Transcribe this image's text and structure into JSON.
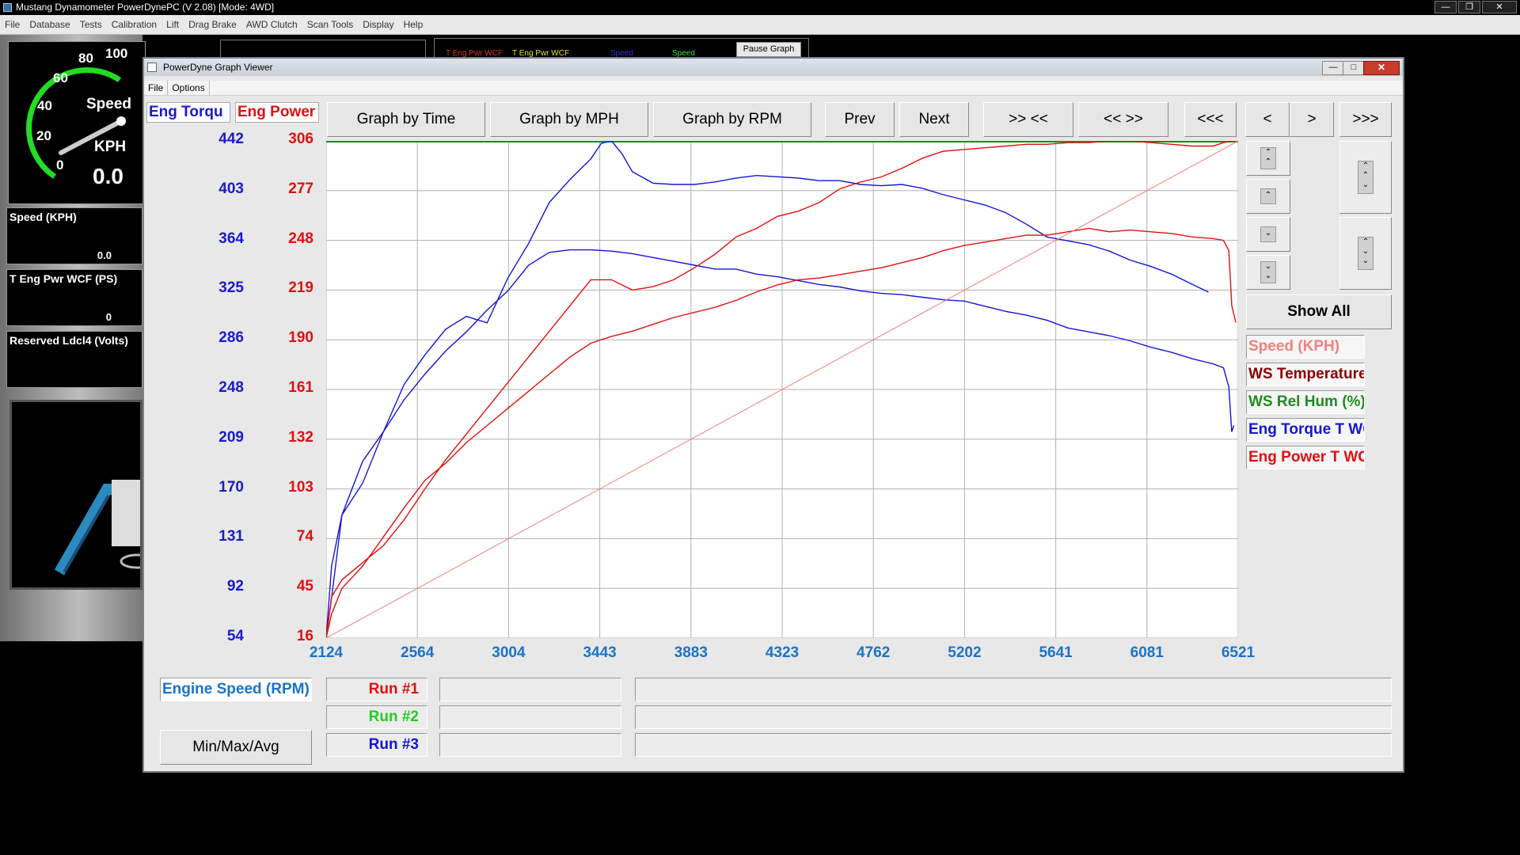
{
  "app": {
    "title": "Mustang Dynamometer PowerDynePC (V 2.08) [Mode: 4WD]",
    "menu": [
      "File",
      "Database",
      "Tests",
      "Calibration",
      "Lift",
      "Drag Brake",
      "AWD Clutch",
      "Scan Tools",
      "Display",
      "Help"
    ]
  },
  "gauge": {
    "ticks": [
      "0",
      "20",
      "40",
      "60",
      "80",
      "100"
    ],
    "label": "Speed",
    "unit": "KPH",
    "value": "0.0",
    "fraction": 0.0
  },
  "side_panels": [
    {
      "label": "Speed (KPH)",
      "value": "0.0"
    },
    {
      "label": "T Eng Pwr WCF (PS)",
      "value": "0"
    },
    {
      "label": "Reserved Ldcl4 (Volts)",
      "value": ""
    }
  ],
  "bg_toolbar": {
    "pause_label": "Pause Graph",
    "legend_a": "T Eng Pwr WCF",
    "legend_b": "T Eng Pwr WCF",
    "legend_c": "Speed",
    "legend_d": "Speed"
  },
  "viewer": {
    "title": "PowerDyne Graph Viewer",
    "menu": [
      "File",
      "Options"
    ],
    "buttons": {
      "by_time": "Graph by Time",
      "by_mph": "Graph by MPH",
      "by_rpm": "Graph by RPM",
      "prev": "Prev",
      "next": "Next",
      "zoom_in": ">> <<",
      "zoom_out": "<< >>",
      "first": "<<<",
      "back": "<",
      "fwd": ">",
      "last": ">>>",
      "show_all": "Show All",
      "min_max_avg": "Min/Max/Avg"
    },
    "legend": [
      {
        "label": "Speed (KPH)",
        "color": "#f08080"
      },
      {
        "label": "WS Temperature (D",
        "color": "#8b0000"
      },
      {
        "label": "WS Rel Hum (%)",
        "color": "#1e8b1e"
      },
      {
        "label": "Eng Torque T WC (N",
        "color": "#1515d0"
      },
      {
        "label": "Eng Power T WC (P",
        "color": "#e01010"
      }
    ],
    "x_axis_label": "Engine Speed (RPM)",
    "runs": [
      {
        "label": "Run #1",
        "color": "#e01010"
      },
      {
        "label": "Run #2",
        "color": "#22cc22"
      },
      {
        "label": "Run #3",
        "color": "#1515d0"
      }
    ]
  },
  "chart_data": {
    "type": "line",
    "y_left_label": "Eng Torqu",
    "y_right_label": "Eng Power",
    "y_left_ticks": [
      "442",
      "403",
      "364",
      "325",
      "286",
      "248",
      "209",
      "170",
      "131",
      "92",
      "54"
    ],
    "y_right_ticks": [
      "306",
      "277",
      "248",
      "219",
      "190",
      "161",
      "132",
      "103",
      "74",
      "45",
      "16"
    ],
    "x_ticks": [
      "2124",
      "2564",
      "3004",
      "3443",
      "3883",
      "4323",
      "4762",
      "5202",
      "5641",
      "6081",
      "6521"
    ],
    "xlim": [
      2124,
      6521
    ],
    "ylim_left": [
      54,
      442
    ],
    "ylim_right": [
      16,
      306
    ],
    "grid": true,
    "series": [
      {
        "name": "Eng Torque T WC (N",
        "axis": "left",
        "color": "#1515d0",
        "x": [
          2124,
          2150,
          2200,
          2300,
          2400,
          2500,
          2600,
          2700,
          2800,
          2900,
          3000,
          3100,
          3200,
          3300,
          3400,
          3450,
          3500,
          3550,
          3600,
          3700,
          3800,
          3900,
          4000,
          4100,
          4200,
          4300,
          4400,
          4500,
          4600,
          4700,
          4800,
          4900,
          5000,
          5100,
          5200,
          5300,
          5400,
          5500,
          5600,
          5700,
          5800,
          5900,
          6000,
          6100,
          6200,
          6300,
          6378
        ],
        "y": [
          54,
          85,
          150,
          192,
          215,
          252,
          275,
          295,
          305,
          300,
          335,
          362,
          394,
          412,
          428,
          440,
          442,
          432,
          418,
          409,
          408,
          408,
          410,
          413,
          415,
          414,
          413,
          411,
          411,
          408,
          407,
          408,
          405,
          400,
          396,
          392,
          386,
          377,
          367,
          364,
          361,
          356,
          349,
          344,
          338,
          330,
          324
        ]
      },
      {
        "name": "Eng Torque T WC (N",
        "axis": "left",
        "color": "#1515d0",
        "x": [
          2124,
          2150,
          2200,
          2300,
          2400,
          2500,
          2600,
          2700,
          2800,
          2900,
          3000,
          3100,
          3200,
          3300,
          3400,
          3500,
          3600,
          3700,
          3800,
          3900,
          4000,
          4100,
          4200,
          4300,
          4400,
          4500,
          4600,
          4700,
          4800,
          4900,
          5000,
          5100,
          5200,
          5300,
          5400,
          5500,
          5600,
          5700,
          5800,
          5900,
          6000,
          6100,
          6200,
          6300,
          6400,
          6450,
          6476,
          6490,
          6500
        ],
        "y": [
          54,
          110,
          150,
          175,
          215,
          240,
          260,
          278,
          293,
          310,
          325,
          345,
          355,
          357,
          357,
          356,
          354,
          351,
          348,
          345,
          342,
          342,
          338,
          336,
          333,
          330,
          328,
          325,
          323,
          322,
          320,
          318,
          317,
          313,
          309,
          306,
          302,
          296,
          293,
          290,
          286,
          281,
          277,
          272,
          268,
          265,
          250,
          215,
          220
        ]
      },
      {
        "name": "Eng Power T WC (P",
        "axis": "right",
        "color": "#e01010",
        "x": [
          2124,
          2150,
          2200,
          2300,
          2400,
          2500,
          2600,
          2700,
          2800,
          2900,
          3000,
          3100,
          3200,
          3300,
          3400,
          3500,
          3600,
          3700,
          3800,
          3900,
          4000,
          4100,
          4200,
          4300,
          4400,
          4500,
          4600,
          4700,
          4800,
          4900,
          5000,
          5100,
          5200,
          5300,
          5400,
          5500,
          5600,
          5700,
          5800,
          5900,
          6000,
          6100,
          6200,
          6300,
          6400,
          6450,
          6490,
          6510
        ],
        "y": [
          16,
          40,
          50,
          60,
          70,
          85,
          103,
          120,
          135,
          150,
          165,
          180,
          195,
          210,
          225,
          225,
          219,
          221,
          225,
          232,
          240,
          250,
          255,
          262,
          265,
          270,
          278,
          282,
          285,
          290,
          296,
          300,
          301,
          302,
          303,
          304,
          304,
          305,
          305,
          306,
          306,
          305,
          304,
          303,
          303,
          305,
          306,
          306
        ]
      },
      {
        "name": "Eng Power T WC (P",
        "axis": "right",
        "color": "#e01010",
        "x": [
          2124,
          2150,
          2200,
          2300,
          2400,
          2500,
          2600,
          2700,
          2800,
          2900,
          3000,
          3100,
          3200,
          3300,
          3400,
          3500,
          3600,
          3700,
          3800,
          3900,
          4000,
          4100,
          4200,
          4300,
          4400,
          4500,
          4600,
          4700,
          4800,
          4900,
          5000,
          5100,
          5200,
          5300,
          5400,
          5500,
          5600,
          5700,
          5800,
          5900,
          6000,
          6100,
          6200,
          6300,
          6400,
          6450,
          6476,
          6490,
          6510
        ],
        "y": [
          16,
          30,
          45,
          58,
          75,
          92,
          108,
          118,
          130,
          140,
          150,
          160,
          170,
          180,
          188,
          192,
          195,
          199,
          203,
          206,
          209,
          213,
          218,
          222,
          225,
          226,
          228,
          230,
          232,
          235,
          238,
          242,
          245,
          247,
          249,
          251,
          251,
          253,
          255,
          253,
          254,
          253,
          252,
          250,
          249,
          248,
          242,
          210,
          200
        ]
      },
      {
        "name": "Speed (KPH)",
        "axis": "left",
        "color": "#f08080",
        "x": [
          2124,
          6521
        ],
        "y": [
          54,
          442
        ]
      }
    ]
  }
}
